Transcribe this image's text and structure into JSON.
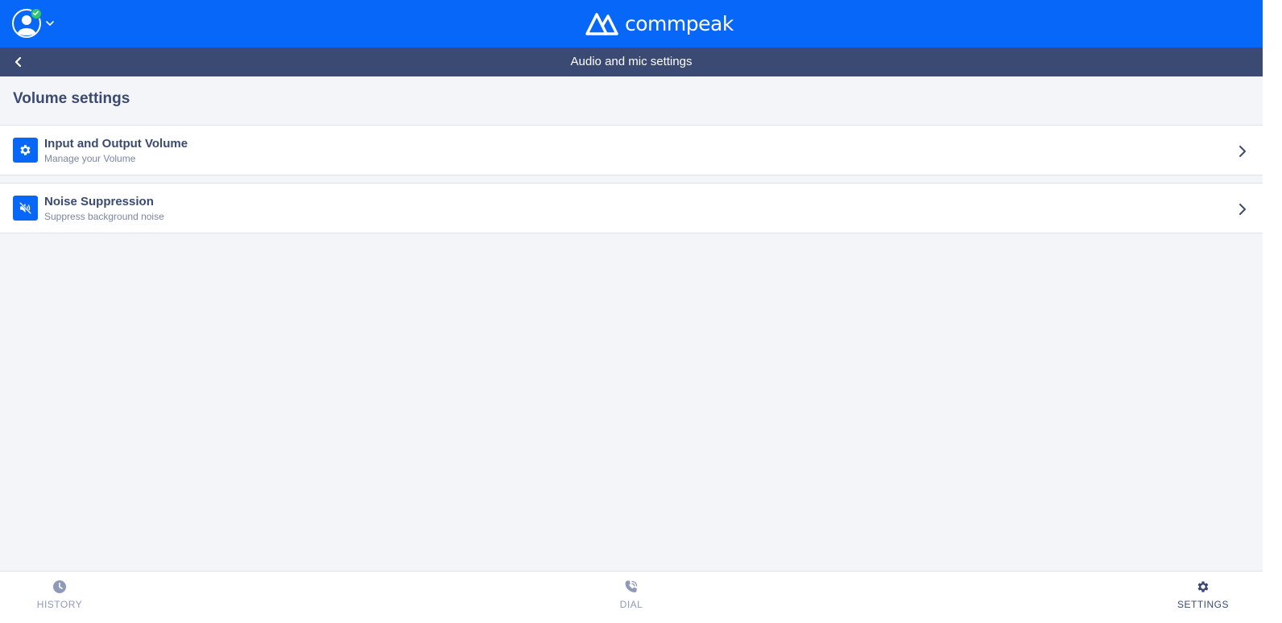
{
  "header": {
    "brand": "commpeak",
    "status": "online"
  },
  "subheader": {
    "title": "Audio and mic settings"
  },
  "section": {
    "title": "Volume settings"
  },
  "items": [
    {
      "title": "Input and Output Volume",
      "subtitle": "Manage your Volume",
      "icon": "gear-icon"
    },
    {
      "title": "Noise Suppression",
      "subtitle": "Suppress background noise",
      "icon": "volume-mute-icon"
    }
  ],
  "nav": [
    {
      "label": "HISTORY",
      "icon": "clock-icon",
      "active": false
    },
    {
      "label": "DIAL",
      "icon": "phone-icon",
      "active": false
    },
    {
      "label": "SETTINGS",
      "icon": "gear-icon",
      "active": true
    }
  ],
  "colors": {
    "primary": "#0767f8",
    "navy": "#3b4a72",
    "background": "#f4f5f9",
    "status_online": "#2dc86e",
    "muted_text": "#7a86a1",
    "nav_inactive": "#8f9ab8"
  }
}
